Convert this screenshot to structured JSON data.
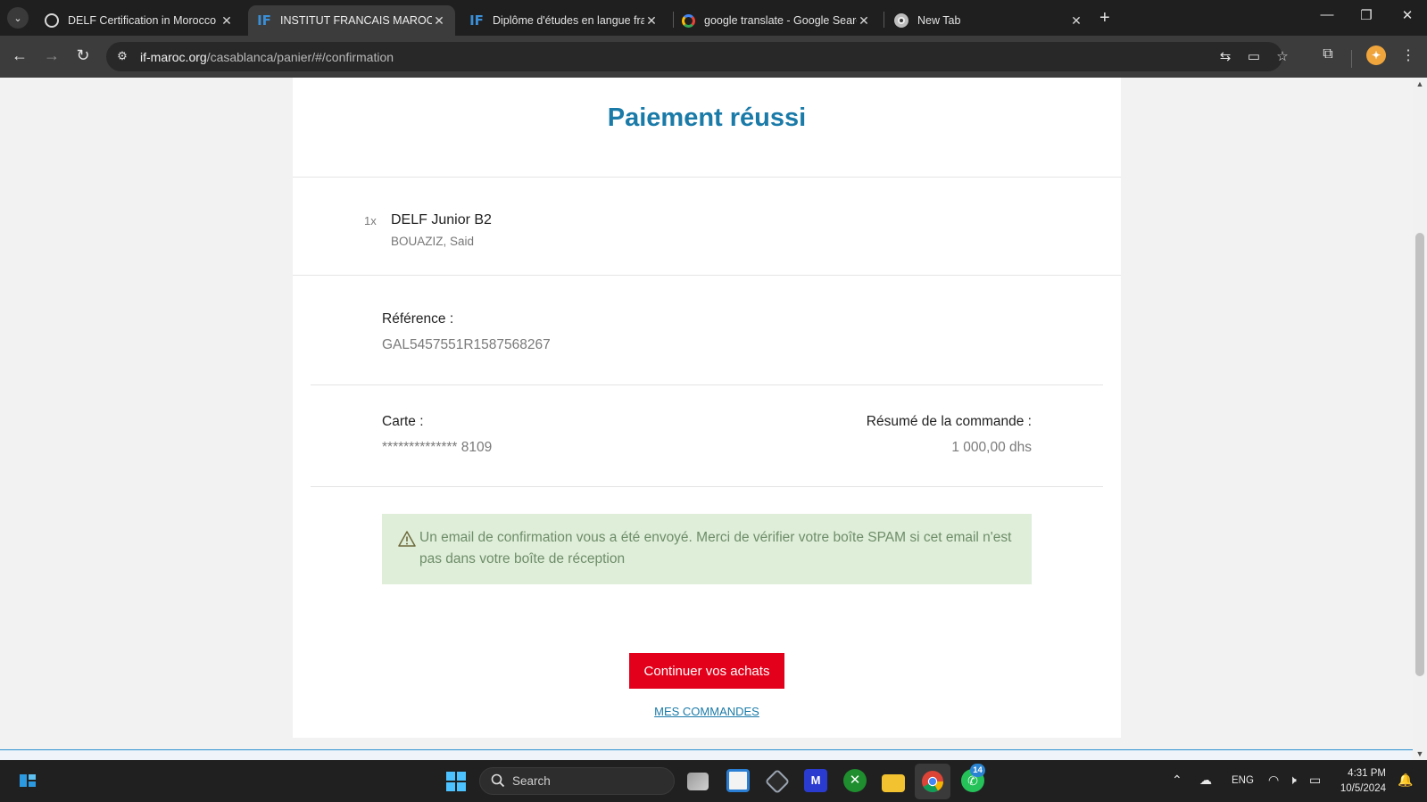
{
  "browser": {
    "tabs": [
      {
        "title": "DELF Certification in Morocco",
        "icon": "openai-icon",
        "active": false
      },
      {
        "title": "INSTITUT FRANCAIS MAROC : Confirmation",
        "icon": "institut-francais-icon",
        "active": true
      },
      {
        "title": "Diplôme d'études en langue française",
        "icon": "institut-francais-icon",
        "active": false
      },
      {
        "title": "google translate - Google Search",
        "icon": "google-icon",
        "active": false
      },
      {
        "title": "New Tab",
        "icon": "chrome-icon",
        "active": false
      }
    ],
    "url_host": "if-maroc.org",
    "url_path": "/casablanca/panier/#/confirmation"
  },
  "page": {
    "title": "Paiement réussi",
    "order_item": {
      "quantity": "1x",
      "name": "DELF Junior B2",
      "holder": "BOUAZIZ, Said"
    },
    "reference": {
      "label": "Référence :",
      "value": "GAL5457551R1587568267"
    },
    "card": {
      "label": "Carte :",
      "value": "************** 8109"
    },
    "summary": {
      "label": "Résumé de la commande :",
      "value": "1 000,00 dhs"
    },
    "alert": {
      "text": "Un email de confirmation vous a été envoyé. Merci de vérifier votre boîte SPAM si cet email n'est pas dans votre boîte de réception"
    },
    "continue_button": "Continuer vos achats",
    "orders_link": "MES COMMANDES"
  },
  "taskbar": {
    "search_placeholder": "Search",
    "whatsapp_badge": "14",
    "language": "ENG",
    "time": "4:31 PM",
    "date": "10/5/2024"
  },
  "colors": {
    "accent": "#1a7aa8",
    "button": "#e2001a",
    "alert_bg": "#dfeed9",
    "alert_text": "#6e8d69"
  }
}
